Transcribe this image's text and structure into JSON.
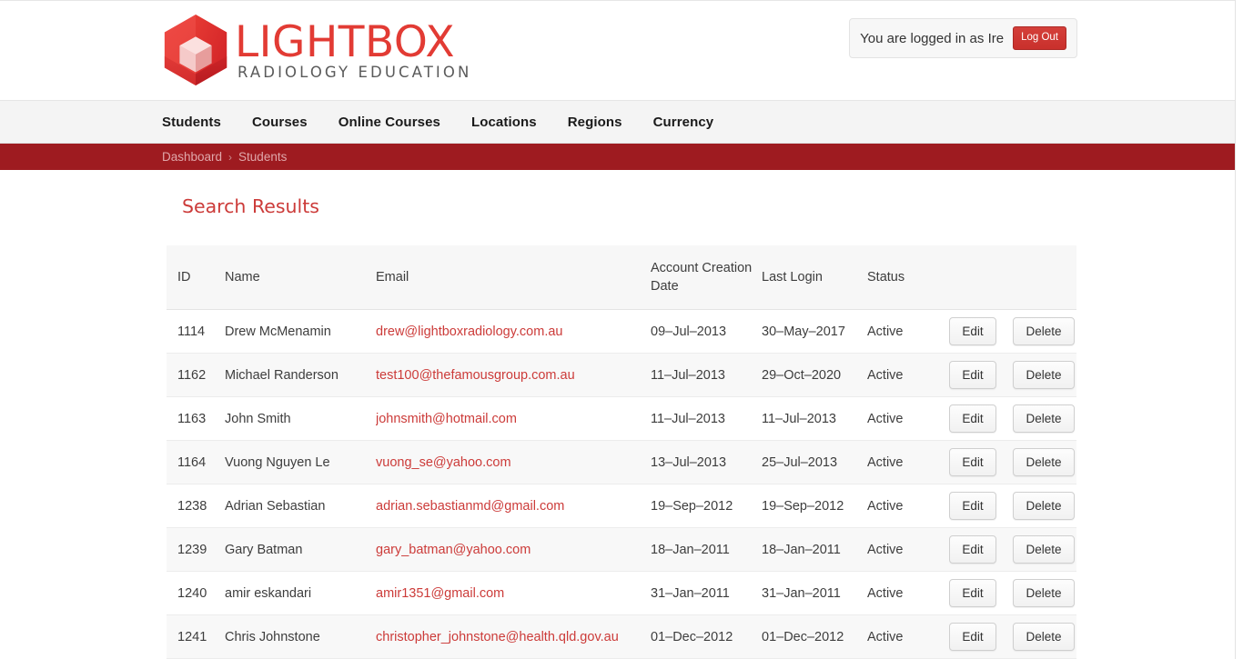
{
  "header": {
    "brand_main": "LIGHTBOX",
    "brand_sub": "RADIOLOGY EDUCATION",
    "logo_icon": "hexagon-cube-logo",
    "brand_color": "#e23b34"
  },
  "account": {
    "logged_in_text": "You are logged in as Ire",
    "logout_label": "Log Out",
    "logout_color": "#c9302c"
  },
  "nav": {
    "items": [
      {
        "label": "Students"
      },
      {
        "label": "Courses"
      },
      {
        "label": "Online Courses"
      },
      {
        "label": "Locations"
      },
      {
        "label": "Regions"
      },
      {
        "label": "Currency"
      }
    ]
  },
  "breadcrumb": {
    "bar_color": "#9e1b20",
    "separator": "›",
    "items": [
      {
        "label": "Dashboard"
      },
      {
        "label": "Students"
      }
    ]
  },
  "main": {
    "title": "Search Results",
    "title_color": "#cc3b39",
    "table": {
      "columns": [
        {
          "label": "ID"
        },
        {
          "label": "Name"
        },
        {
          "label": "Email"
        },
        {
          "label": "Account Creation Date"
        },
        {
          "label": "Last Login"
        },
        {
          "label": "Status"
        },
        {
          "label": ""
        }
      ],
      "row_actions": {
        "edit_label": "Edit",
        "delete_label": "Delete"
      },
      "rows": [
        {
          "id": "1114",
          "name": "Drew McMenamin",
          "email": "drew@lightboxradiology.com.au",
          "created": "09–Jul–2013",
          "last_login": "30–May–2017",
          "status": "Active"
        },
        {
          "id": "1162",
          "name": "Michael Randerson",
          "email": "test100@thefamousgroup.com.au",
          "created": "11–Jul–2013",
          "last_login": "29–Oct–2020",
          "status": "Active"
        },
        {
          "id": "1163",
          "name": "John Smith",
          "email": "johnsmith@hotmail.com",
          "created": "11–Jul–2013",
          "last_login": "11–Jul–2013",
          "status": "Active"
        },
        {
          "id": "1164",
          "name": "Vuong Nguyen Le",
          "email": "vuong_se@yahoo.com",
          "created": "13–Jul–2013",
          "last_login": "25–Jul–2013",
          "status": "Active"
        },
        {
          "id": "1238",
          "name": "Adrian Sebastian",
          "email": "adrian.sebastianmd@gmail.com",
          "created": "19–Sep–2012",
          "last_login": "19–Sep–2012",
          "status": "Active"
        },
        {
          "id": "1239",
          "name": "Gary Batman",
          "email": "gary_batman@yahoo.com",
          "created": "18–Jan–2011",
          "last_login": "18–Jan–2011",
          "status": "Active"
        },
        {
          "id": "1240",
          "name": "amir eskandari",
          "email": "amir1351@gmail.com",
          "created": "31–Jan–2011",
          "last_login": "31–Jan–2011",
          "status": "Active"
        },
        {
          "id": "1241",
          "name": "Chris Johnstone",
          "email": "christopher_johnstone@health.qld.gov.au",
          "created": "01–Dec–2012",
          "last_login": "01–Dec–2012",
          "status": "Active"
        }
      ]
    }
  }
}
